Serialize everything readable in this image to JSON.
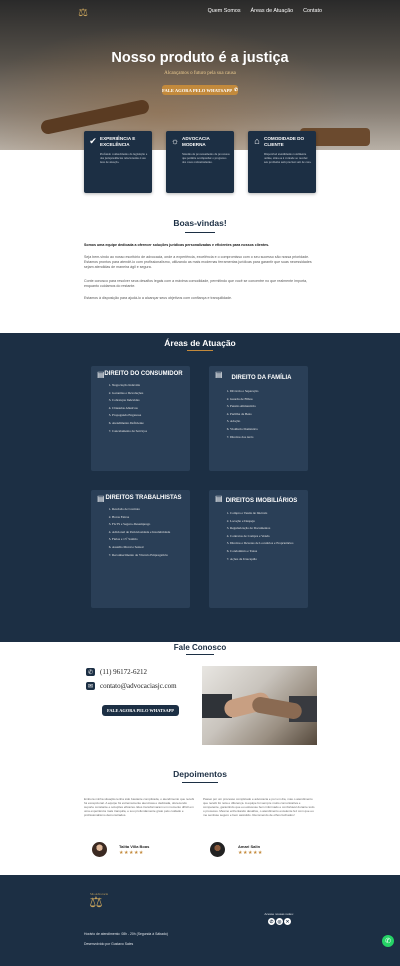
{
  "nav": {
    "items": [
      "Quem Somos",
      "Áreas de Atuação",
      "Contato"
    ]
  },
  "hero": {
    "title": "Nosso produto é a justiça",
    "subtitle": "Alcançamos o futuro pela sua causa",
    "button": "FALE AGORA PELO WHATSAPP"
  },
  "features": [
    {
      "title": "EXPERIÊNCIA E EXCELÊNCIA",
      "text": "Profundo conhecimento da legislação e das jurisprudências relacionadas à sua área de atuação.",
      "icon": "check-circle-icon"
    },
    {
      "title": "ADVOCACIA MODERNA",
      "text": "Sistema de processamento de processos que permite acompanhar o progresso dos casos rotineiramente.",
      "icon": "lightbulb-icon"
    },
    {
      "title": "COMODIDADE DO CLIENTE",
      "text": "Disponível atendimento totalmente online, sinta-se à vontade ao receber seu problema sem precisar sair de casa.",
      "icon": "home-icon"
    }
  ],
  "welcome": {
    "title": "Boas-vindas!",
    "lead": "Somos uma equipe dedicada a oferecer soluções jurídicas personalizadas e eficientes para nossos clientes.",
    "p1": "Seja bem-vindo ao nosso escritório de advocacia, onde a experiência, excelência e o compromisso com o seu sucesso são nossa prioridade. Estamos prontos para atendê-lo com profissionalismo, utilizando as mais modernas ferramentas jurídicas para garantir que suas necessidades sejam atendidas de maneira ágil e segura.",
    "p2": "Conte conosco para resolver seus desafios legais com a máxima comodidade, permitindo que você se concentre no que realmente importa, enquanto cuidamos do restante.",
    "p3": "Estamos à disposição para ajudá-lo a alcançar seus objetivos com confiança e tranquilidade."
  },
  "areas": {
    "title": "Áreas de Atuação",
    "cards": [
      {
        "title": "DIREITO DO CONSUMIDOR",
        "items": [
          "Negociação Indevida",
          "Garantias e Devoluções",
          "Cobranças Indevidas",
          "Cláusulas Abusivas",
          "Propaganda Enganosa",
          "Atendimento Deficiente",
          "Cancelamento de Serviços"
        ]
      },
      {
        "title": "DIREITO DA FAMÍLIA",
        "items": [
          "Divórcio e Separação",
          "Guarda de Filhos",
          "Pensão Alimentícia",
          "Partilha de Bens",
          "Adoção",
          "Violência Doméstica",
          "Direitos dos Avós"
        ]
      },
      {
        "title": "DIREITOS TRABALHISTAS",
        "items": [
          "Rescisão de Contrato",
          "Horas Extras",
          "FGTS e Seguro-Desemprego",
          "Adicional de Periculosidade e Insalubridade",
          "Férias e 13º Salário",
          "Assédio Moral e Sexual",
          "Reconhecimento de Vínculo Empregatício"
        ]
      },
      {
        "title": "DIREITOS IMOBILIÁRIOS",
        "items": [
          "Compra e Venda de Imóveis",
          "Locação e Despejo",
          "Regularização de Documentos",
          "Contratos de Compra e Venda",
          "Direitos e Deveres de Locatários e Proprietários",
          "Condomínio e Taxas",
          "Ações de Usucapião"
        ]
      }
    ]
  },
  "contact": {
    "title": "Fale Conosco",
    "phone": "(11) 96172-6212",
    "email": "contato@advocaciasjc.com",
    "button": "FALE AGORA PELO WHATSAPP"
  },
  "testimonials": {
    "title": "Depoimentos",
    "items": [
      {
        "text": "Embora minha situação tenha sido bastante complicada, o atendimento que recebi foi excepcional. A equipe foi extremamente atenciosa e dedicada, oferecendo suporte constante e soluções eficazes. Eles transformaram um momento difícil em uma experiência mais tranquila, e sou profundamente grato pelo cuidado e profissionalismo demonstrados.",
        "name": "Talita Villa Boas",
        "stars": "★★★★★"
      },
      {
        "text": "Passei por um processo complicado e advocacia e por um dia, mas o atendimento que recebi foi nota e diferença. A equipe foi sempre muito comunicativa e competente, garantindo que eu estivesse bem informado e confortável durante todo o processo. Mesmo enfrentando desafios, o atendimento excelente fez com que eu me sentisse seguro e bem assistido. Recomendo de olhos fechados!",
        "name": "Amari Salin",
        "stars": "★★★★★"
      }
    ]
  },
  "footer": {
    "logo_text": "São Advocacia",
    "hours": "Horário de atendimento: 08h - 20h (Segunda à Sábado)",
    "credit": "Desenvolvido por Gustavo Sales",
    "social_label": "Acesse nossas redes:",
    "social": [
      "whatsapp-icon",
      "instagram-icon",
      "twitter-icon"
    ]
  },
  "colors": {
    "navy": "#1c2f44",
    "gold": "#c38a3c",
    "whatsapp": "#25d366"
  }
}
